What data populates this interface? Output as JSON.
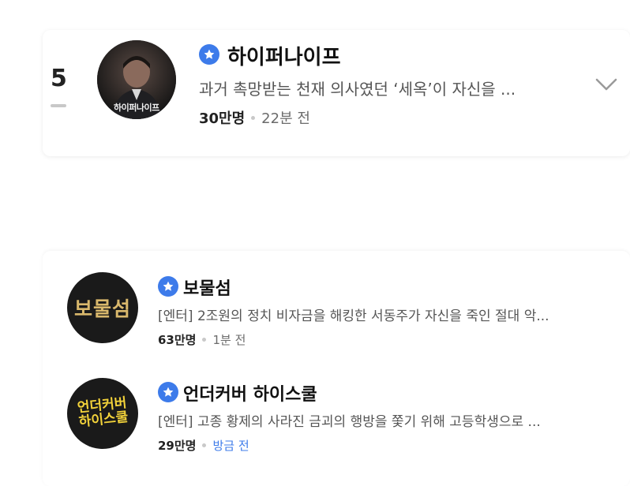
{
  "featured": {
    "rank": "5",
    "title": "하이퍼나이프",
    "description": "과거 촉망받는 천재 의사였던 ‘세옥’이 자신을 ...",
    "viewers": "30만명",
    "time": "22분 전",
    "poster_text": "하이퍼나이프",
    "chevron_icon": "chevron-down-icon"
  },
  "items": [
    {
      "title": "보물섬",
      "description": "[엔터] 2조원의 정치 비자금을 해킹한 서동주가 자신을 죽인 절대 악...",
      "viewers": "63만명",
      "time": "1분 전",
      "logo_text": "보물섬"
    },
    {
      "title": "언더커버 하이스쿨",
      "description": "[엔터] 고종 황제의 사라진 금괴의 행방을 쫓기 위해 고등학생으로 ...",
      "viewers": "29만명",
      "time": "방금 전",
      "logo_text_line1": "언더커버",
      "logo_text_line2": "하이스쿨"
    }
  ],
  "colors": {
    "accent": "#3d7bea",
    "muted": "#6b6b6b"
  },
  "badge_icon": "star-badge-icon"
}
